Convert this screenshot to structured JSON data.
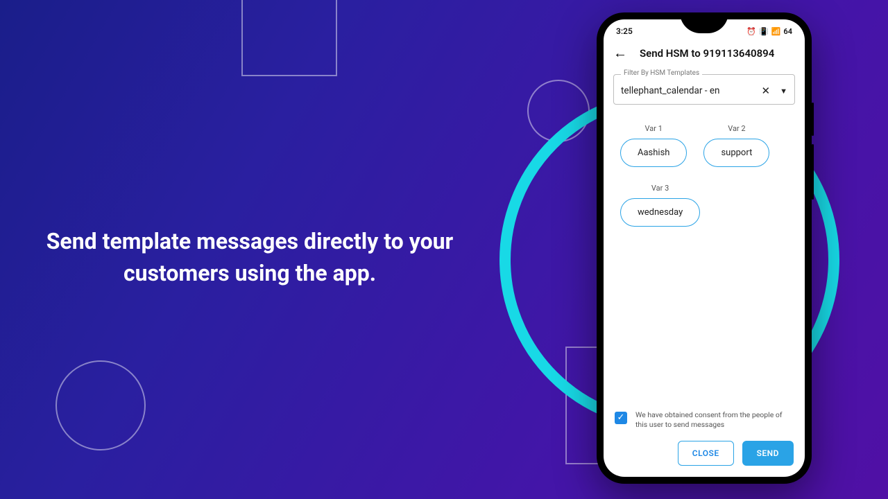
{
  "promo": {
    "headline": "Send template messages directly to your customers using the app."
  },
  "status": {
    "time": "3:25",
    "icons": {
      "alarm": "⏰",
      "vibrate": "📳",
      "signal": "📶",
      "battery_pct": "64"
    }
  },
  "appbar": {
    "title": "Send HSM to 919113640894"
  },
  "filter": {
    "label": "Filter By HSM Templates",
    "value": "tellephant_calendar - en"
  },
  "vars": [
    {
      "label": "Var 1",
      "value": "Aashish"
    },
    {
      "label": "Var 2",
      "value": "support"
    },
    {
      "label": "Var 3",
      "value": "wednesday"
    }
  ],
  "consent": {
    "checked": true,
    "text": "We have obtained consent from the people of this user to send messages"
  },
  "buttons": {
    "close": "CLOSE",
    "send": "SEND"
  }
}
